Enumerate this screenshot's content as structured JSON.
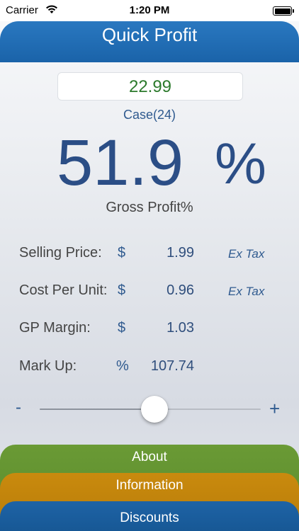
{
  "status_bar": {
    "carrier": "Carrier",
    "time": "1:20 PM",
    "icons": [
      "wifi-icon",
      "battery-icon"
    ]
  },
  "header": {
    "title": "Quick Profit"
  },
  "price_input": {
    "value": "22.99"
  },
  "unit_label": "Case(24)",
  "gross_profit": {
    "value": "51.9",
    "symbol": "%",
    "label": "Gross Profit%"
  },
  "rows": [
    {
      "label": "Selling Price:",
      "symbol": "$",
      "value": "1.99",
      "note": "Ex Tax"
    },
    {
      "label": "Cost Per Unit:",
      "symbol": "$",
      "value": "0.96",
      "note": "Ex Tax"
    },
    {
      "label": "GP Margin:",
      "symbol": "$",
      "value": "1.03",
      "note": ""
    },
    {
      "label": "Mark Up:",
      "symbol": "%",
      "value": "107.74",
      "note": ""
    }
  ],
  "slider": {
    "minus": "-",
    "plus": "+",
    "level": 0.52
  },
  "tabs": {
    "about": "About",
    "information": "Information",
    "discounts": "Discounts"
  },
  "colors": {
    "header": "#1a63a9",
    "accent_text": "#2b4e86",
    "input_value": "#2c7a2c",
    "about_tab": "#5a8a2c",
    "information_tab": "#b87c09",
    "discounts_tab": "#175895"
  }
}
